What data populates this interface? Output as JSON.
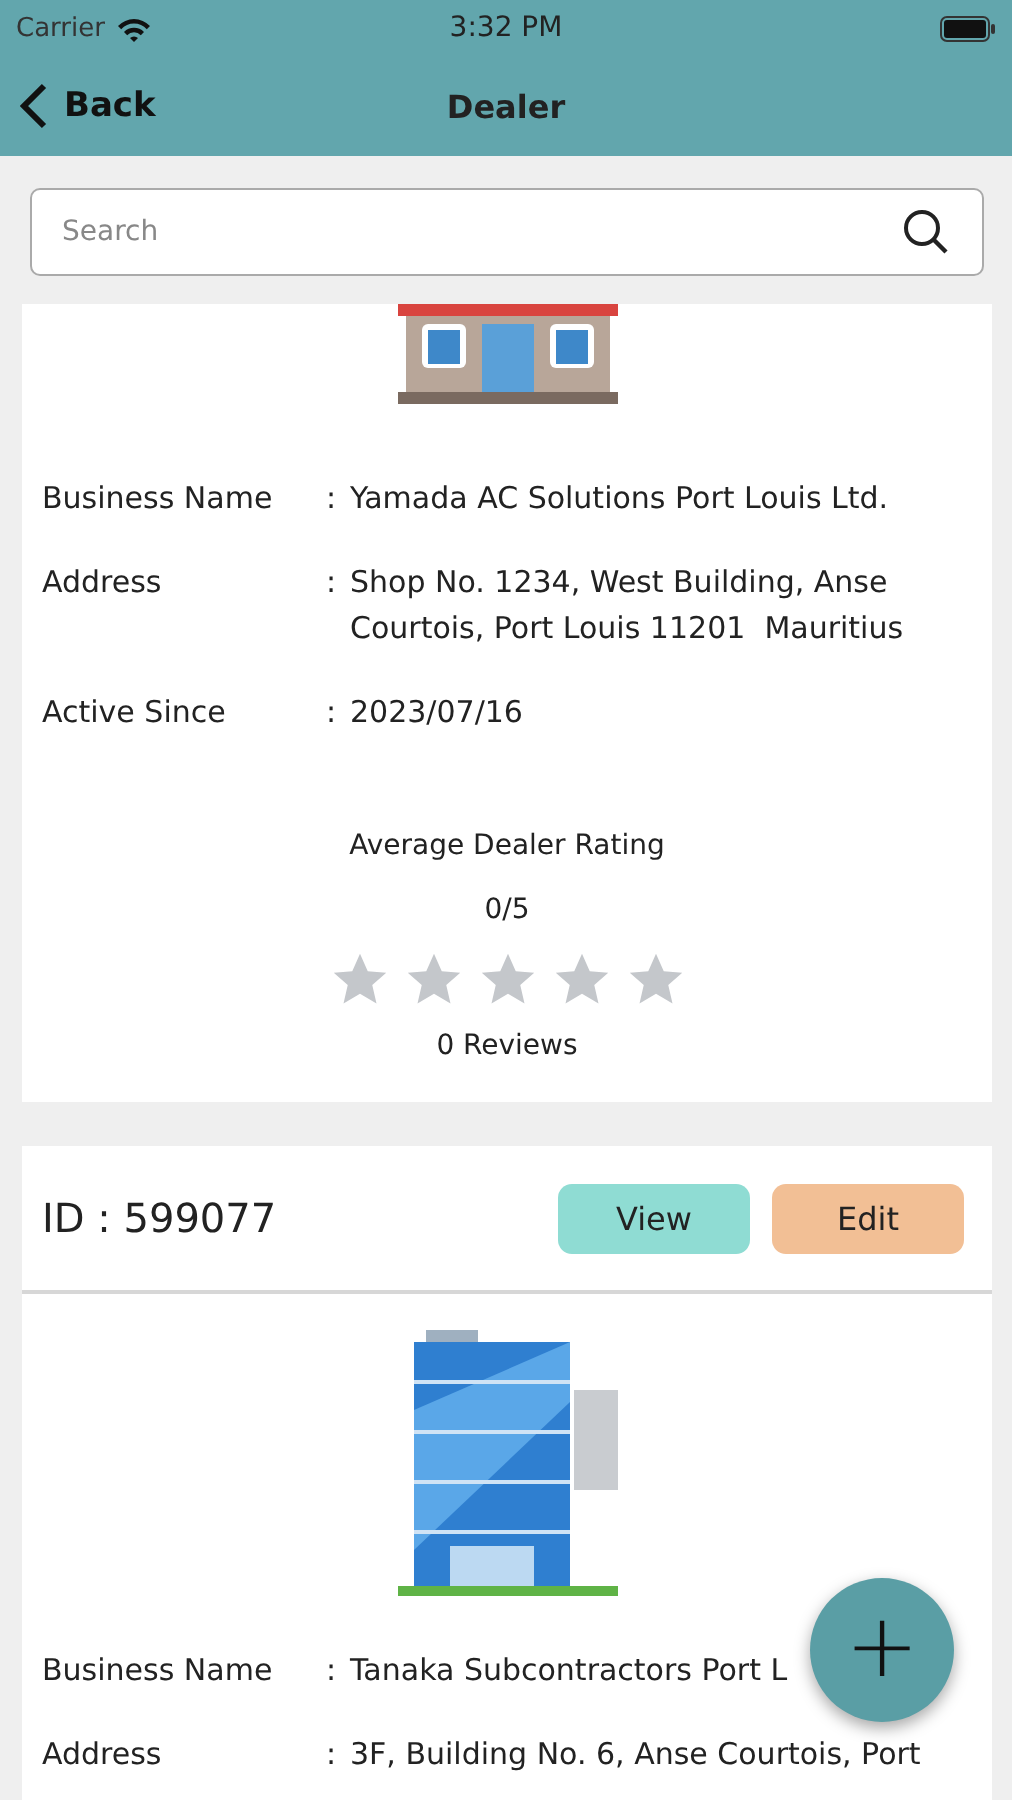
{
  "status_bar": {
    "carrier": "Carrier",
    "time": "3:32 PM"
  },
  "nav": {
    "back": "Back",
    "title": "Dealer"
  },
  "search": {
    "placeholder": "Search"
  },
  "dealers": [
    {
      "kind": "shop",
      "fields": [
        {
          "label": "Business Name",
          "sep": ":",
          "value": "Yamada AC Solutions Port Louis Ltd."
        },
        {
          "label": "Address",
          "sep": ":",
          "value": "Shop No. 1234, West Building, Anse Courtois, Port Louis 11201  Mauritius"
        },
        {
          "label": "Active Since",
          "sep": ":",
          "value": "2023/07/16"
        }
      ],
      "rating": {
        "title": "Average Dealer Rating",
        "score": "0/5",
        "stars": 0,
        "reviews": "0 Reviews"
      }
    },
    {
      "id_label": "ID : 599077",
      "kind": "office",
      "buttons": [
        "View",
        "Edit"
      ],
      "fields": [
        {
          "label": "Business Name",
          "sep": ":",
          "value": "Tanaka Subcontractors Port L"
        },
        {
          "label": "Address",
          "sep": ":",
          "value": "3F, Building No. 6, Anse Courtois, Port"
        }
      ]
    }
  ],
  "fab": "+"
}
